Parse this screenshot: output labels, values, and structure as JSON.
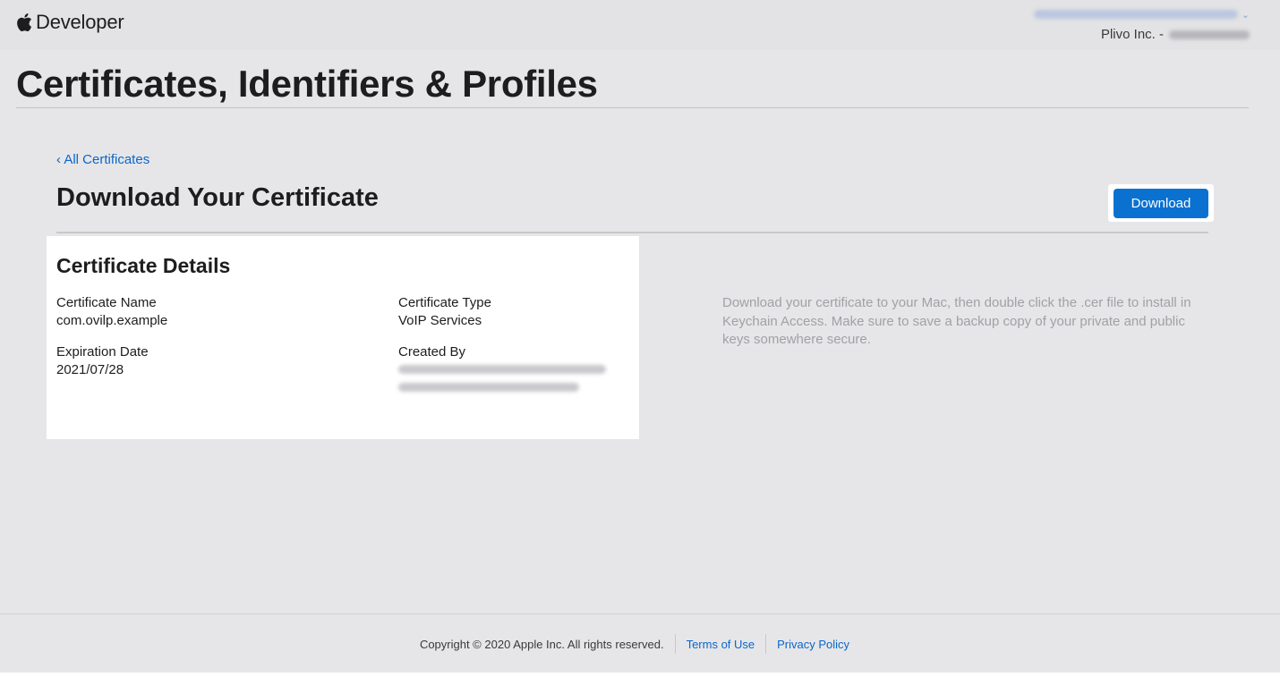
{
  "header": {
    "brand_label": "Developer",
    "team_label": "Plivo Inc. -"
  },
  "page": {
    "title": "Certificates, Identifiers & Profiles",
    "back_link": "‹ All Certificates",
    "section_title": "Download Your Certificate",
    "download_button": "Download"
  },
  "details": {
    "title": "Certificate Details",
    "fields": {
      "name_label": "Certificate Name",
      "name_value": "com.ovilp.example",
      "type_label": "Certificate Type",
      "type_value": "VoIP Services",
      "expiration_label": "Expiration Date",
      "expiration_value": "2021/07/28",
      "created_label": "Created By"
    }
  },
  "info": {
    "text": "Download your certificate to your Mac, then double click the .cer file to install in Keychain Access. Make sure to save a backup copy of your private and public keys somewhere secure."
  },
  "footer": {
    "copyright": "Copyright © 2020 Apple Inc. All rights reserved.",
    "terms": "Terms of Use",
    "privacy": "Privacy Policy"
  },
  "colors": {
    "accent": "#0a71d1",
    "link": "#0b66c9",
    "background": "#e6e6e8"
  }
}
